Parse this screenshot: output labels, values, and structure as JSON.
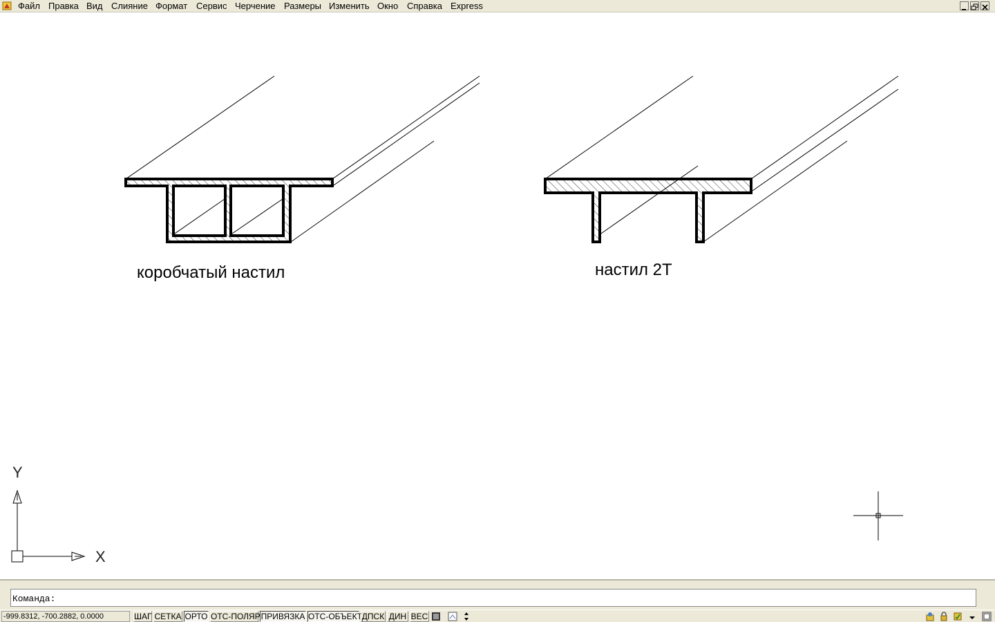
{
  "menubar": {
    "items": [
      "Файл",
      "Правка",
      "Вид",
      "Слияние",
      "Формат",
      "Сервис",
      "Черчение",
      "Размеры",
      "Изменить",
      "Окно",
      "Справка",
      "Express"
    ]
  },
  "drawing": {
    "labels": {
      "box_deck": "коробчатый настил",
      "tee_deck": "настил 2Т"
    },
    "ucs": {
      "x": "X",
      "y": "Y"
    }
  },
  "command": {
    "prompt": "Команда:"
  },
  "status": {
    "coordinates": "-999.8312, -700.2882, 0.0000",
    "buttons": [
      {
        "label": "ШАГ",
        "on": false
      },
      {
        "label": "СЕТКА",
        "on": false
      },
      {
        "label": "ОРТО",
        "on": true
      },
      {
        "label": "ОТС-ПОЛЯР",
        "on": false
      },
      {
        "label": "ПРИВЯЗКА",
        "on": true
      },
      {
        "label": "ОТС-ОБЪЕКТ",
        "on": true
      },
      {
        "label": "ДПСК",
        "on": false
      },
      {
        "label": "ДИН",
        "on": false
      },
      {
        "label": "ВЕС",
        "on": false
      }
    ]
  },
  "colors": {
    "ui_background": "#ece9d8",
    "canvas": "#ffffff",
    "lines": "#000000"
  }
}
